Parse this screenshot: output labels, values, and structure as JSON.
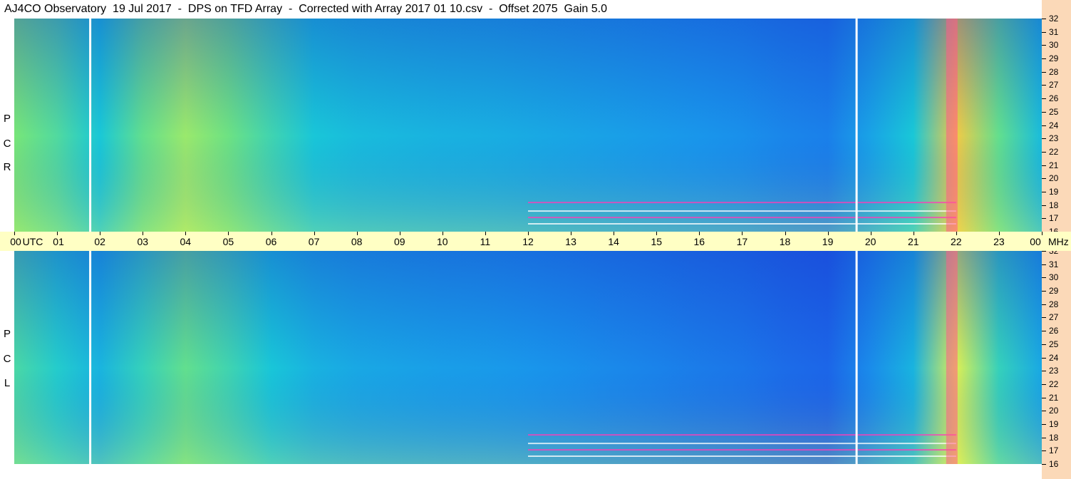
{
  "title": "AJ4CO Observatory  19 Jul 2017  -  DPS on TFD Array  -  Corrected with Array 2017 01 10.csv  -  Offset 2075  Gain 5.0",
  "panels": {
    "top": {
      "label_chars": [
        "P",
        "C",
        "R"
      ]
    },
    "bottom": {
      "label_chars": [
        "P",
        "C",
        "L"
      ]
    }
  },
  "time_axis": {
    "labels": [
      "00",
      "UTC",
      "01",
      "02",
      "03",
      "04",
      "05",
      "06",
      "07",
      "08",
      "09",
      "10",
      "11",
      "12",
      "13",
      "14",
      "15",
      "16",
      "17",
      "18",
      "19",
      "20",
      "21",
      "22",
      "23",
      "00"
    ],
    "unit": "MHz"
  },
  "colors": {
    "time_axis_bg": "#ffffc4",
    "freq_axis_bg": "#fbd9b8",
    "low_intensity": "#1f4fe6",
    "mid_intensity": "#19c4d8",
    "high_intensity": "#e8f25a",
    "peak_intensity": "#ff3cb8"
  },
  "chart_data": {
    "type": "heatmap",
    "title": "AJ4CO Observatory  19 Jul 2017  -  DPS on TFD Array  -  Corrected with Array 2017 01 10.csv  -  Offset 2075  Gain 5.0",
    "xlabel": "UTC",
    "ylabel": "MHz",
    "x_ticks": [
      "00",
      "01",
      "02",
      "03",
      "04",
      "05",
      "06",
      "07",
      "08",
      "09",
      "10",
      "11",
      "12",
      "13",
      "14",
      "15",
      "16",
      "17",
      "18",
      "19",
      "20",
      "21",
      "22",
      "23",
      "00"
    ],
    "xlim": [
      0,
      24
    ],
    "ylim": [
      16,
      32
    ],
    "y_ticks": [
      16,
      17,
      18,
      19,
      20,
      21,
      22,
      23,
      24,
      25,
      26,
      27,
      28,
      29,
      30,
      31,
      32
    ],
    "panels": [
      {
        "name": "RCP",
        "label": "R C P"
      },
      {
        "name": "LCP",
        "label": "L C P"
      }
    ],
    "intensity_profile_by_hour": [
      {
        "hour": 0,
        "level": 0.62
      },
      {
        "hour": 1,
        "level": 0.55
      },
      {
        "hour": 2,
        "level": 0.45
      },
      {
        "hour": 3,
        "level": 0.58
      },
      {
        "hour": 4,
        "level": 0.66
      },
      {
        "hour": 5,
        "level": 0.6
      },
      {
        "hour": 6,
        "level": 0.52
      },
      {
        "hour": 7,
        "level": 0.44
      },
      {
        "hour": 8,
        "level": 0.4
      },
      {
        "hour": 9,
        "level": 0.38
      },
      {
        "hour": 10,
        "level": 0.36
      },
      {
        "hour": 11,
        "level": 0.35
      },
      {
        "hour": 12,
        "level": 0.33
      },
      {
        "hour": 13,
        "level": 0.31
      },
      {
        "hour": 14,
        "level": 0.29
      },
      {
        "hour": 15,
        "level": 0.27
      },
      {
        "hour": 16,
        "level": 0.25
      },
      {
        "hour": 17,
        "level": 0.23
      },
      {
        "hour": 18,
        "level": 0.2
      },
      {
        "hour": 19,
        "level": 0.18
      },
      {
        "hour": 20,
        "level": 0.3
      },
      {
        "hour": 21,
        "level": 0.45
      },
      {
        "hour": 22,
        "level": 0.82
      },
      {
        "hour": 23,
        "level": 0.58
      },
      {
        "hour": 24,
        "level": 0.4
      }
    ],
    "vertical_gaps_hours": [
      1.75,
      19.65
    ],
    "bright_band_hour": 21.9
  }
}
